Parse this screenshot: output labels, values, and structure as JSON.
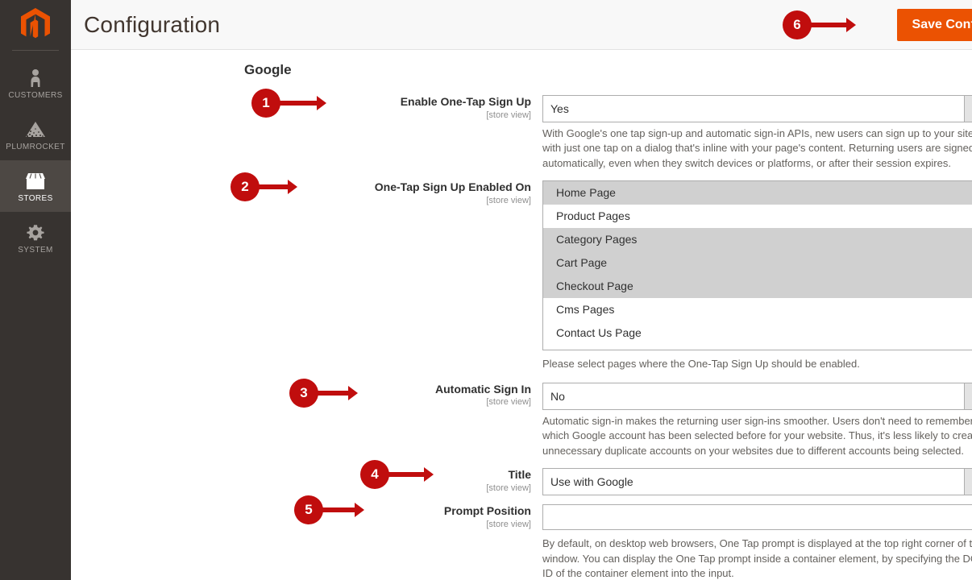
{
  "sidebar": {
    "logo": {
      "icon": "magento-logo-icon"
    },
    "items": [
      {
        "id": "customers",
        "label": "CUSTOMERS",
        "icon": "person-icon",
        "active": false
      },
      {
        "id": "plumrocket",
        "label": "PLUMROCKET",
        "icon": "pyramid-icon",
        "active": false
      },
      {
        "id": "stores",
        "label": "STORES",
        "icon": "store-icon",
        "active": true
      },
      {
        "id": "system",
        "label": "SYSTEM",
        "icon": "gear-icon",
        "active": false
      }
    ]
  },
  "header": {
    "title": "Configuration",
    "save_label": "Save Config"
  },
  "section": {
    "title": "Google",
    "collapse_icon": "chevron-up-icon"
  },
  "fields": {
    "enable_one_tap": {
      "label": "Enable One-Tap Sign Up",
      "scope": "[store view]",
      "value": "Yes",
      "note": "With Google's one tap sign-up and automatic sign-in APIs, new users can sign up to your site with just one tap on a dialog that's inline with your page's content. Returning users are signed in automatically, even when they switch devices or platforms, or after their session expires."
    },
    "enabled_on": {
      "label": "One-Tap Sign Up Enabled On",
      "scope": "[store view]",
      "note": "Please select pages where the One-Tap Sign Up should be enabled.",
      "options": [
        {
          "label": "Home Page",
          "selected": true
        },
        {
          "label": "Product Pages",
          "selected": false
        },
        {
          "label": "Category Pages",
          "selected": true
        },
        {
          "label": "Cart Page",
          "selected": true
        },
        {
          "label": "Checkout Page",
          "selected": true
        },
        {
          "label": "Cms Pages",
          "selected": false
        },
        {
          "label": "Contact Us Page",
          "selected": false
        }
      ]
    },
    "automatic_sign_in": {
      "label": "Automatic Sign In",
      "scope": "[store view]",
      "value": "No",
      "note": "Automatic sign-in makes the returning user sign-ins smoother. Users don't need to remember which Google account has been selected before for your website. Thus, it's less likely to create unnecessary duplicate accounts on your websites due to different accounts being selected."
    },
    "title": {
      "label": "Title",
      "scope": "[store view]",
      "value": "Use with Google"
    },
    "prompt_position": {
      "label": "Prompt Position",
      "scope": "[store view]",
      "value": "",
      "placeholder": "",
      "note": "By default, on desktop web browsers, One Tap prompt is displayed at the top right corner of the window. You can display the One Tap prompt inside a container element, by specifying the DOM ID of the container element into the input."
    }
  },
  "annotations": [
    {
      "number": "1",
      "target": "enable-one-tap-field"
    },
    {
      "number": "2",
      "target": "one-tap-enabled-on-field"
    },
    {
      "number": "3",
      "target": "automatic-sign-in-field"
    },
    {
      "number": "4",
      "target": "title-field"
    },
    {
      "number": "5",
      "target": "prompt-position-field"
    },
    {
      "number": "6",
      "target": "save-config-button"
    }
  ],
  "colors": {
    "accent": "#eb5202",
    "sidebar_bg": "#373330",
    "annotation": "#c00d0d"
  }
}
